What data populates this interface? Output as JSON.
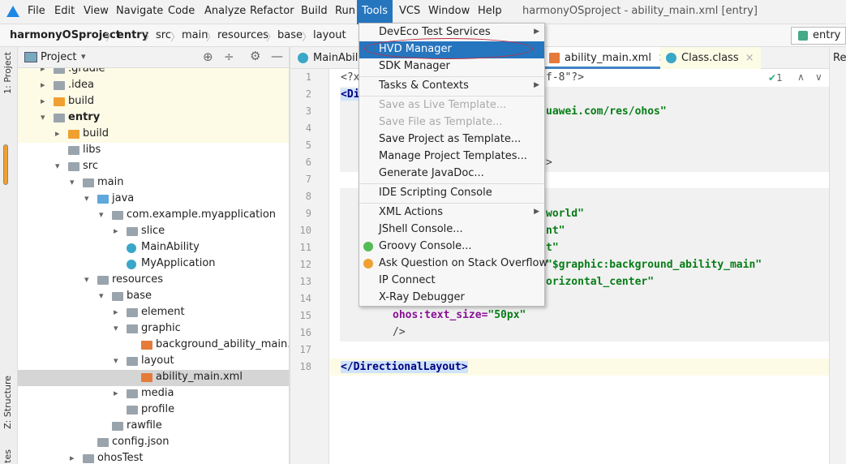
{
  "menubar": {
    "items": [
      "File",
      "Edit",
      "View",
      "Navigate",
      "Code",
      "Analyze",
      "Refactor",
      "Build",
      "Run",
      "Tools",
      "VCS",
      "Window",
      "Help"
    ],
    "active": "Tools",
    "window_title": "harmonyOSproject - ability_main.xml [entry]"
  },
  "breadcrumb": [
    "harmonyOSproject",
    "entry",
    "src",
    "main",
    "resources",
    "base",
    "layout"
  ],
  "run_config": "entry",
  "left_strip": {
    "project": "1: Project",
    "structure": "Z: Structure",
    "favorites": "tes"
  },
  "project_panel": {
    "title": "Project",
    "dropdown": "▾"
  },
  "tree": [
    {
      "label": ".gradle",
      "depth": 0,
      "arrow": "›",
      "icon": "folder"
    },
    {
      "label": ".idea",
      "depth": 0,
      "arrow": "›",
      "icon": "folder"
    },
    {
      "label": "build",
      "depth": 0,
      "arrow": "›",
      "icon": "folder-orange"
    },
    {
      "label": "entry",
      "depth": 0,
      "arrow": "⌄",
      "icon": "folder",
      "bold": true
    },
    {
      "label": "build",
      "depth": 1,
      "arrow": "›",
      "icon": "folder-orange"
    },
    {
      "label": "libs",
      "depth": 1,
      "arrow": "",
      "icon": "folder"
    },
    {
      "label": "src",
      "depth": 1,
      "arrow": "⌄",
      "icon": "folder"
    },
    {
      "label": "main",
      "depth": 2,
      "arrow": "⌄",
      "icon": "folder"
    },
    {
      "label": "java",
      "depth": 3,
      "arrow": "⌄",
      "icon": "folder-blue"
    },
    {
      "label": "com.example.myapplication",
      "depth": 4,
      "arrow": "⌄",
      "icon": "folder"
    },
    {
      "label": "slice",
      "depth": 5,
      "arrow": "›",
      "icon": "folder"
    },
    {
      "label": "MainAbility",
      "depth": 5,
      "arrow": "",
      "icon": "class"
    },
    {
      "label": "MyApplication",
      "depth": 5,
      "arrow": "",
      "icon": "class"
    },
    {
      "label": "resources",
      "depth": 3,
      "arrow": "⌄",
      "icon": "folder"
    },
    {
      "label": "base",
      "depth": 4,
      "arrow": "⌄",
      "icon": "folder"
    },
    {
      "label": "element",
      "depth": 5,
      "arrow": "›",
      "icon": "folder"
    },
    {
      "label": "graphic",
      "depth": 5,
      "arrow": "⌄",
      "icon": "folder"
    },
    {
      "label": "background_ability_main.xml",
      "depth": 6,
      "arrow": "",
      "icon": "xml"
    },
    {
      "label": "layout",
      "depth": 5,
      "arrow": "⌄",
      "icon": "folder"
    },
    {
      "label": "ability_main.xml",
      "depth": 6,
      "arrow": "",
      "icon": "xml",
      "selected": true
    },
    {
      "label": "media",
      "depth": 5,
      "arrow": "›",
      "icon": "folder"
    },
    {
      "label": "profile",
      "depth": 5,
      "arrow": "",
      "icon": "folder"
    },
    {
      "label": "rawfile",
      "depth": 4,
      "arrow": "",
      "icon": "folder"
    },
    {
      "label": "config.json",
      "depth": 3,
      "arrow": "",
      "icon": "json"
    },
    {
      "label": "ohosTest",
      "depth": 2,
      "arrow": "›",
      "icon": "folder"
    }
  ],
  "tabs": [
    {
      "label": "MainAbili",
      "icon": "class"
    },
    {
      "label": "ability_main.xml",
      "icon": "xml",
      "active": true
    },
    {
      "label": "Class.class",
      "icon": "class"
    }
  ],
  "right_panel_label": "Re",
  "inspection": {
    "count": "1"
  },
  "code_lines": [
    {
      "n": "1",
      "left": "<?x",
      "right": "f-8\"?>"
    },
    {
      "n": "2",
      "left": "<Di",
      "right": ""
    },
    {
      "n": "3",
      "left": "",
      "right": "uawei.com/res/ohos\""
    },
    {
      "n": "4",
      "left": "",
      "right": ""
    },
    {
      "n": "5",
      "left": "",
      "right": ""
    },
    {
      "n": "6",
      "left": "",
      "right": ">"
    },
    {
      "n": "7",
      "left": "",
      "right": ""
    },
    {
      "n": "8",
      "left": "",
      "right": ""
    },
    {
      "n": "9",
      "left": "",
      "right": "world\""
    },
    {
      "n": "10",
      "left": "",
      "right": "nt\""
    },
    {
      "n": "11",
      "left": "",
      "right": "t\""
    },
    {
      "n": "12",
      "left": "",
      "right": "\"$graphic:background_ability_main\""
    },
    {
      "n": "13",
      "left": "",
      "right": "orizontal_center\""
    },
    {
      "n": "14",
      "left": "",
      "right": ""
    },
    {
      "n": "15",
      "left": "",
      "right": ""
    },
    {
      "n": "16",
      "left": "",
      "right": ""
    },
    {
      "n": "17",
      "left": "",
      "right": ""
    },
    {
      "n": "18",
      "left": "</DirectionalLayout>",
      "right": ""
    }
  ],
  "line15": {
    "attr": "ohos:text_size=",
    "value": "\"50px\""
  },
  "line16": "/>",
  "tools_menu": [
    {
      "label": "DevEco Test Services",
      "submenu": true
    },
    {
      "label": "HVD Manager",
      "highlighted": true
    },
    {
      "label": "SDK Manager"
    },
    {
      "sep": true
    },
    {
      "label": "Tasks & Contexts",
      "submenu": true
    },
    {
      "sep": true
    },
    {
      "label": "Save as Live Template...",
      "disabled": true
    },
    {
      "label": "Save File as Template...",
      "disabled": true
    },
    {
      "label": "Save Project as Template..."
    },
    {
      "label": "Manage Project Templates..."
    },
    {
      "label": "Generate JavaDoc..."
    },
    {
      "sep": true
    },
    {
      "label": "IDE Scripting Console"
    },
    {
      "sep": true
    },
    {
      "label": "XML Actions",
      "submenu": true
    },
    {
      "label": "JShell Console..."
    },
    {
      "label": "Groovy Console...",
      "icon": "groovy-icon"
    },
    {
      "label": "Ask Question on Stack Overflow",
      "icon": "stackoverflow-icon"
    },
    {
      "label": "IP Connect"
    },
    {
      "label": "X-Ray Debugger"
    }
  ],
  "colors": {
    "accent": "#2675bf",
    "annotation": "#c03040"
  }
}
